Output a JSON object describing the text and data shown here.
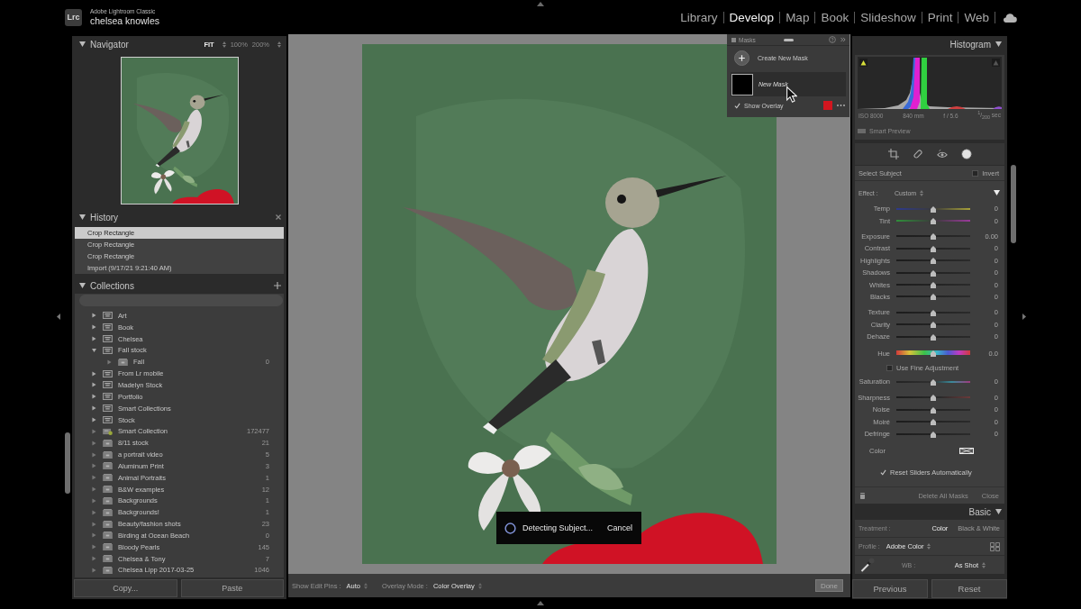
{
  "header": {
    "logo": "Lrc",
    "app_name": "Adobe Lightroom Classic",
    "user": "chelsea knowles",
    "modules": [
      {
        "label": "Library",
        "selected": false
      },
      {
        "label": "Develop",
        "selected": true
      },
      {
        "label": "Map",
        "selected": false
      },
      {
        "label": "Book",
        "selected": false
      },
      {
        "label": "Slideshow",
        "selected": false
      },
      {
        "label": "Print",
        "selected": false
      },
      {
        "label": "Web",
        "selected": false
      }
    ]
  },
  "navigator": {
    "title": "Navigator",
    "zoom_options": [
      {
        "label": "FIT",
        "selected": true
      },
      {
        "label": "100%",
        "selected": false
      },
      {
        "label": "200%",
        "selected": false
      }
    ]
  },
  "history": {
    "title": "History",
    "items": [
      {
        "label": "Crop Rectangle",
        "selected": true
      },
      {
        "label": "Crop Rectangle",
        "selected": false
      },
      {
        "label": "Crop Rectangle",
        "selected": false
      },
      {
        "label": "Import (9/17/21 9:21:40 AM)",
        "selected": false
      }
    ]
  },
  "collections": {
    "title": "Collections",
    "items": [
      {
        "name": "Art",
        "kind": "set",
        "expanded": false
      },
      {
        "name": "Book",
        "kind": "set",
        "expanded": false
      },
      {
        "name": "Chelsea",
        "kind": "set",
        "expanded": false
      },
      {
        "name": "Fall stock",
        "kind": "set",
        "expanded": true,
        "children": [
          {
            "name": "Fall",
            "kind": "collection",
            "count": "0",
            "expanded": false
          }
        ]
      },
      {
        "name": "From Lr mobile",
        "kind": "set",
        "expanded": false
      },
      {
        "name": "Madelyn Stock",
        "kind": "set",
        "expanded": false
      },
      {
        "name": "Portfolio",
        "kind": "set",
        "expanded": false
      },
      {
        "name": "Smart Collections",
        "kind": "set",
        "expanded": false
      },
      {
        "name": "Stock",
        "kind": "set",
        "expanded": false
      },
      {
        "name": "Smart Collection",
        "kind": "smart",
        "count": "172477",
        "expanded": false
      },
      {
        "name": "8/11 stock",
        "kind": "collection",
        "count": "21",
        "expanded": false
      },
      {
        "name": "a portrait video",
        "kind": "collection",
        "count": "5",
        "expanded": false
      },
      {
        "name": "Aluminum Print",
        "kind": "collection",
        "count": "3",
        "expanded": false
      },
      {
        "name": "Animal Portraits",
        "kind": "collection",
        "count": "1",
        "expanded": false
      },
      {
        "name": "B&W examples",
        "kind": "collection",
        "count": "12",
        "expanded": false
      },
      {
        "name": "Backgrounds",
        "kind": "collection",
        "count": "1",
        "expanded": false
      },
      {
        "name": "Backgrounds!",
        "kind": "collection",
        "count": "1",
        "expanded": false
      },
      {
        "name": "Beauty/fashion shots",
        "kind": "collection",
        "count": "23",
        "expanded": false
      },
      {
        "name": "Birding at Ocean Beach",
        "kind": "collection",
        "count": "0",
        "expanded": false
      },
      {
        "name": "Bloody Pearls",
        "kind": "collection",
        "count": "145",
        "expanded": false
      },
      {
        "name": "Chelsea & Tony",
        "kind": "collection",
        "count": "7",
        "expanded": false
      },
      {
        "name": "Chelsea Lipp 2017-03-25",
        "kind": "collection",
        "count": "1046",
        "expanded": false
      }
    ]
  },
  "left_buttons": [
    {
      "label": "Copy..."
    },
    {
      "label": "Paste"
    }
  ],
  "masks": {
    "title": "Masks",
    "create_label": "Create New Mask",
    "items": [
      {
        "name": "New Mask",
        "selected": true
      }
    ],
    "overlay": {
      "label": "Show Overlay",
      "checked": true,
      "color": "#d2161f"
    }
  },
  "progress": {
    "message": "Detecting Subject...",
    "cancel": "Cancel"
  },
  "toolbar": {
    "options": [
      {
        "label": "Show Edit Pins :",
        "value": "Auto"
      },
      {
        "label": "Overlay Mode :",
        "value": "Color Overlay"
      }
    ],
    "done": {
      "label": "Done",
      "disabled": true
    }
  },
  "histogram": {
    "title": "Histogram",
    "info": [
      "ISO 8000",
      "840 mm",
      "f / 5.6",
      "$^{1}$/$_{200}$ sec"
    ],
    "smart_preview": "Smart Preview"
  },
  "mask_settings": {
    "title": "Select Subject",
    "invert": {
      "label": "Invert",
      "checked": false
    },
    "effect": {
      "label": "Effect :",
      "value": "Custom"
    },
    "groups": [
      [
        {
          "kind": "temp",
          "label": "Temp",
          "value": "0",
          "level": 0.5
        },
        {
          "kind": "tint",
          "label": "Tint",
          "value": "0",
          "level": 0.5
        }
      ],
      [
        {
          "kind": "plain",
          "label": "Exposure",
          "value": "0.00",
          "level": 0.5
        },
        {
          "kind": "plain",
          "label": "Contrast",
          "value": "0",
          "level": 0.5
        },
        {
          "kind": "plain",
          "label": "Highlights",
          "value": "0",
          "level": 0.5
        },
        {
          "kind": "plain",
          "label": "Shadows",
          "value": "0",
          "level": 0.5
        },
        {
          "kind": "plain",
          "label": "Whites",
          "value": "0",
          "level": 0.5
        },
        {
          "kind": "plain",
          "label": "Blacks",
          "value": "0",
          "level": 0.5
        }
      ],
      [
        {
          "kind": "plain",
          "label": "Texture",
          "value": "0",
          "level": 0.5
        },
        {
          "kind": "plain",
          "label": "Clarity",
          "value": "0",
          "level": 0.5
        },
        {
          "kind": "plain",
          "label": "Dehaze",
          "value": "0",
          "level": 0.5
        }
      ],
      [
        {
          "kind": "hue",
          "label": "Hue",
          "value": "0.0",
          "level": 0.5
        },
        {
          "kind": "checkbox",
          "label": "Use Fine Adjustment",
          "checked": false
        },
        {
          "kind": "saturation",
          "label": "Saturation",
          "value": "0",
          "level": 0.5
        }
      ],
      [
        {
          "kind": "sharpness",
          "label": "Sharpness",
          "value": "0",
          "level": 0.5
        },
        {
          "kind": "plain",
          "label": "Noise",
          "value": "0",
          "level": 0.5
        },
        {
          "kind": "plain",
          "label": "Moiré",
          "value": "0",
          "level": 0.5
        },
        {
          "kind": "plain",
          "label": "Defringe",
          "value": "0",
          "level": 0.5
        }
      ]
    ],
    "color_label": "Color",
    "reset": {
      "label": "Reset Sliders Automatically",
      "checked": true
    },
    "delete_label": "Delete All Masks",
    "close_label": "Close"
  },
  "basic": {
    "title": "Basic",
    "treatment": {
      "label": "Treatment :",
      "options": [
        {
          "label": "Color",
          "selected": true
        },
        {
          "label": "Black & White",
          "selected": false
        }
      ]
    },
    "profile": {
      "label": "Profile :",
      "value": "Adobe Color"
    },
    "wb": {
      "label": "WB :",
      "value": "As Shot"
    }
  },
  "right_buttons": [
    {
      "label": "Previous"
    },
    {
      "label": "Reset"
    }
  ]
}
